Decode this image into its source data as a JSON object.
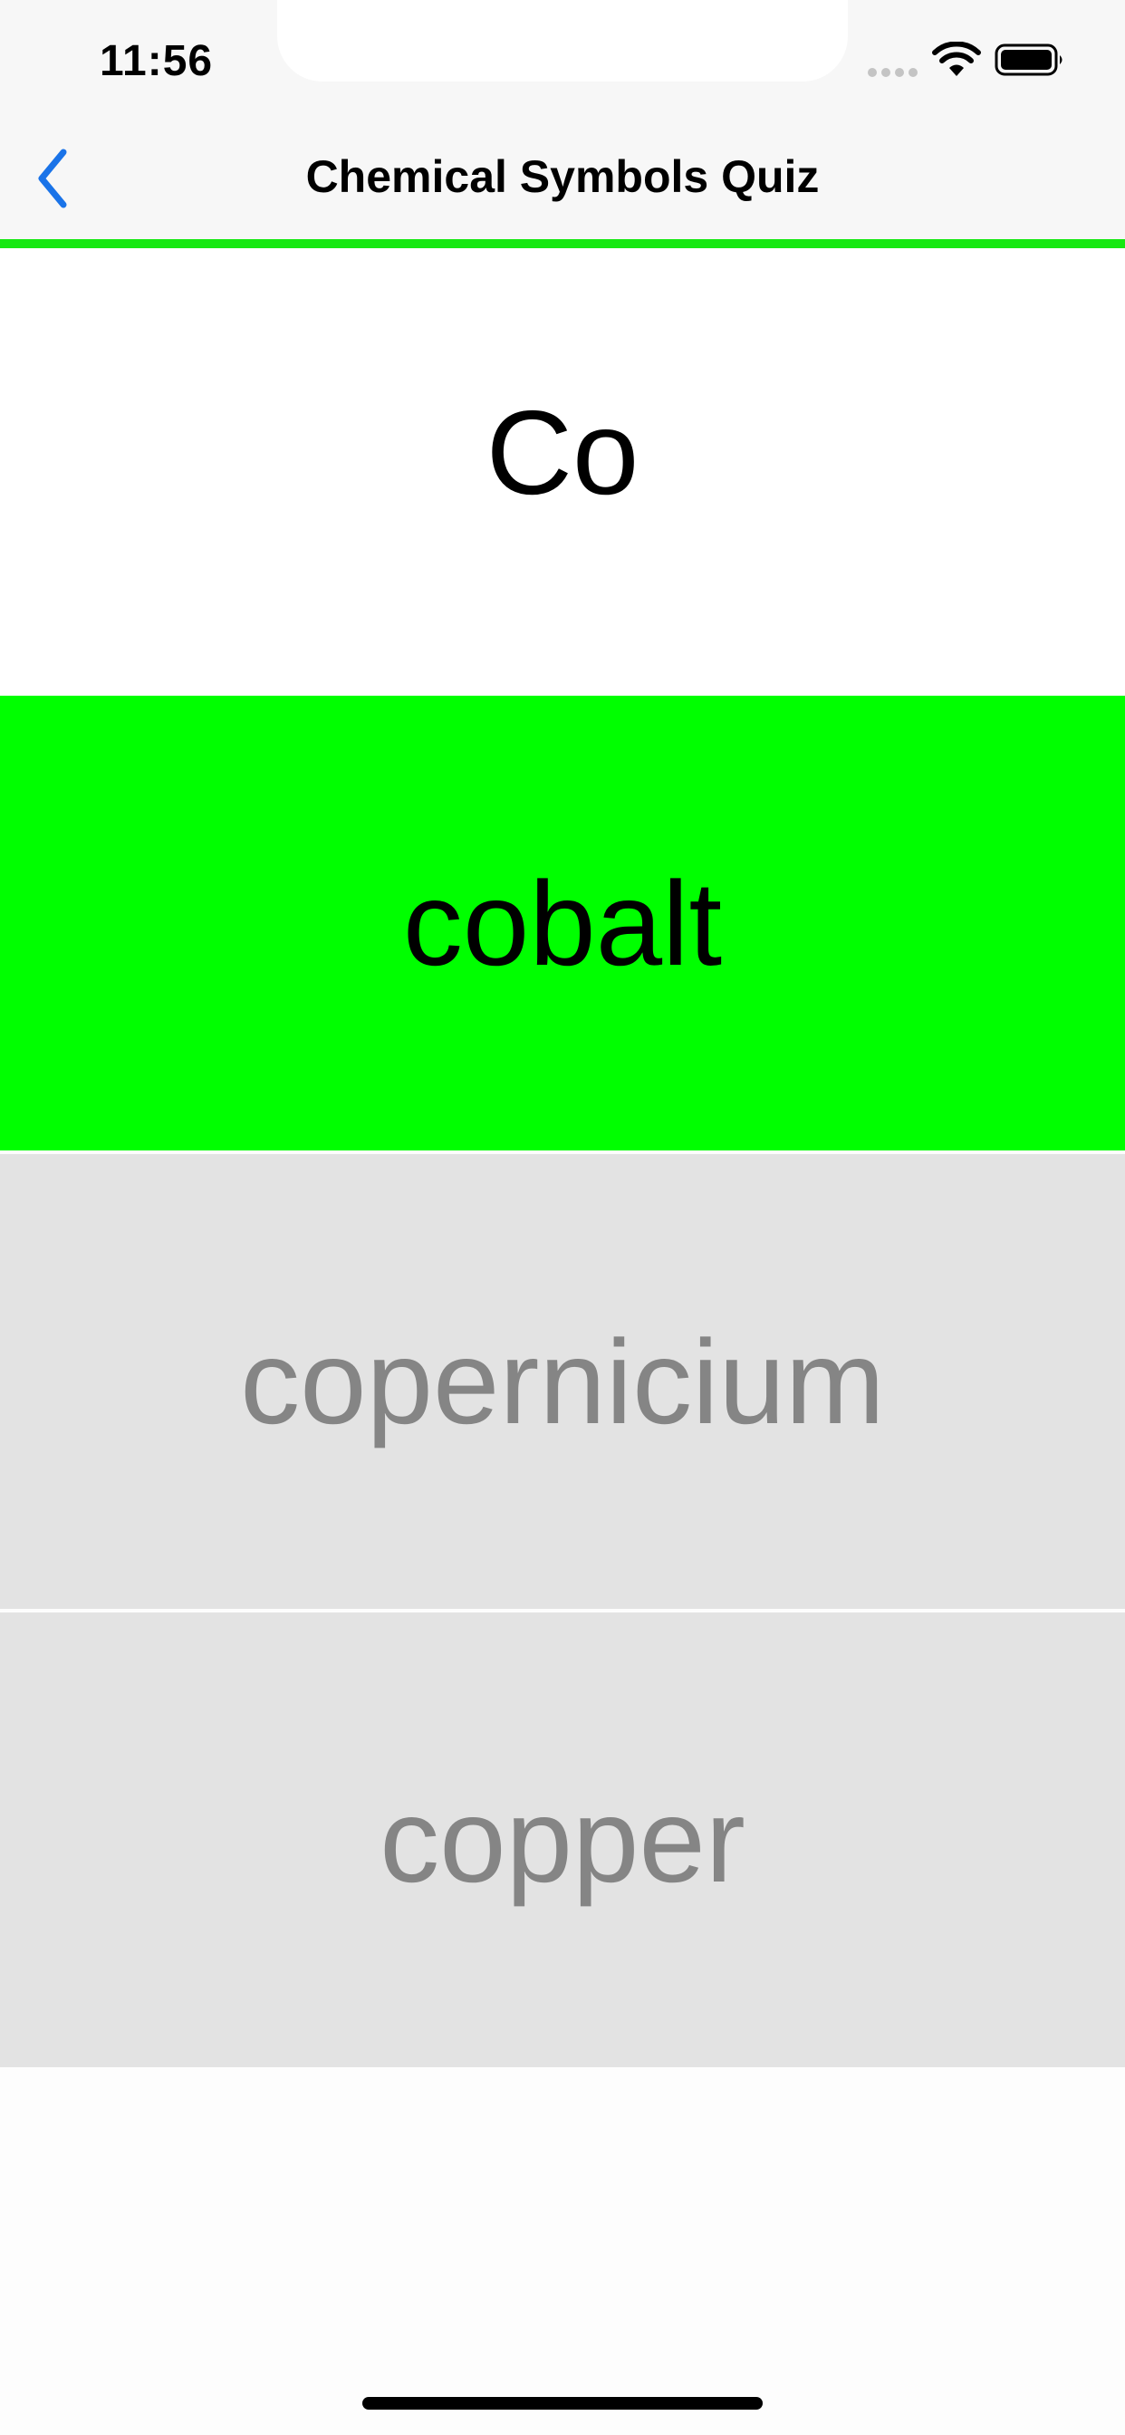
{
  "status_bar": {
    "time": "11:56",
    "icons": [
      "cellular-signal-icon",
      "wifi-icon",
      "battery-icon"
    ]
  },
  "nav": {
    "back_icon": "chevron-left-icon",
    "title": "Chemical Symbols Quiz"
  },
  "progress": {
    "fraction": 1.0,
    "color": "#16e812"
  },
  "question": {
    "symbol": "Co"
  },
  "answers": [
    {
      "label": "cobalt",
      "state": "correct",
      "color": "#00ff00"
    },
    {
      "label": "copernicium",
      "state": "disabled"
    },
    {
      "label": "copper",
      "state": "disabled"
    }
  ],
  "colors": {
    "accent_blue": "#1a73e8",
    "correct_green": "#00ff00",
    "disabled_bg": "#e3e3e3",
    "disabled_text": "#858585"
  }
}
